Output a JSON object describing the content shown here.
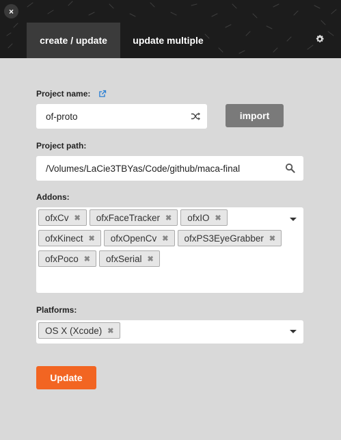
{
  "window": {
    "close_label": "×"
  },
  "tabs": [
    {
      "label": "create / update",
      "active": true
    },
    {
      "label": "update multiple",
      "active": false
    }
  ],
  "project_name": {
    "label": "Project name:",
    "value": "of-proto"
  },
  "import_label": "import",
  "project_path": {
    "label": "Project path:",
    "value": "/Volumes/LaCie3TBYas/Code/github/maca-final"
  },
  "addons": {
    "label": "Addons:",
    "items": [
      "ofxCv",
      "ofxFaceTracker",
      "ofxIO",
      "ofxKinect",
      "ofxOpenCv",
      "ofxPS3EyeGrabber",
      "ofxPoco",
      "ofxSerial"
    ]
  },
  "platforms": {
    "label": "Platforms:",
    "items": [
      "OS X (Xcode)"
    ]
  },
  "update_label": "Update",
  "colors": {
    "accent": "#f26522",
    "header_bg": "#1c1c1c",
    "active_tab": "#3b3b3b",
    "link_icon": "#2a7fd4",
    "import_bg": "#7a7a7a"
  }
}
